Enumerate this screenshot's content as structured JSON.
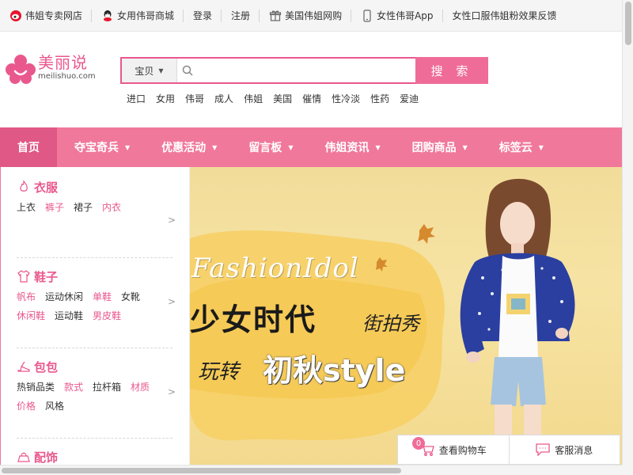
{
  "topbar": {
    "items": [
      {
        "label": "伟姐专卖网店",
        "icon": "weibo-icon"
      },
      {
        "label": "女用伟哥商城",
        "icon": "qq-icon"
      },
      {
        "label": "登录"
      },
      {
        "label": "注册"
      },
      {
        "label": "美国伟姐网购",
        "icon": "gift-icon"
      },
      {
        "label": "女性伟哥App",
        "icon": "phone-icon"
      },
      {
        "label": "女性口服伟姐粉效果反馈"
      }
    ]
  },
  "logo": {
    "name": "美丽说",
    "domain": "meilishuo.com"
  },
  "search": {
    "category": "宝贝",
    "placeholder": "",
    "button_label": "搜 索"
  },
  "hotwords": [
    "进口",
    "女用",
    "伟哥",
    "成人",
    "伟姐",
    "美国",
    "催情",
    "性冷淡",
    "性药",
    "爱迪"
  ],
  "nav": {
    "items": [
      {
        "label": "首页",
        "active": true
      },
      {
        "label": "夺宝奇兵"
      },
      {
        "label": "优惠活动"
      },
      {
        "label": "留言板"
      },
      {
        "label": "伟姐资讯"
      },
      {
        "label": "团购商品"
      },
      {
        "label": "标签云"
      }
    ]
  },
  "sidebar": {
    "categories": [
      {
        "name": "衣服",
        "icon": "flame-icon",
        "rows": [
          [
            {
              "t": "上衣"
            },
            {
              "t": "裤子",
              "hl": true
            },
            {
              "t": "裙子"
            },
            {
              "t": "内衣",
              "hl": true
            }
          ]
        ]
      },
      {
        "name": "鞋子",
        "icon": "tshirt-icon",
        "rows": [
          [
            {
              "t": "帆布",
              "hl": true
            },
            {
              "t": "运动休闲"
            },
            {
              "t": "单鞋",
              "hl": true
            },
            {
              "t": "女靴"
            }
          ],
          [
            {
              "t": "休闲鞋",
              "hl": true
            },
            {
              "t": "运动鞋"
            },
            {
              "t": "男皮鞋",
              "hl": true
            }
          ]
        ]
      },
      {
        "name": "包包",
        "icon": "heel-icon",
        "rows": [
          [
            {
              "t": "热销品类"
            },
            {
              "t": "款式",
              "hl": true
            },
            {
              "t": "拉杆箱"
            },
            {
              "t": "材质",
              "hl": true
            }
          ],
          [
            {
              "t": "价格",
              "hl": true
            },
            {
              "t": "风格"
            }
          ]
        ]
      },
      {
        "name": "配饰",
        "icon": "bag-icon",
        "rows": []
      }
    ],
    "arrow": ">"
  },
  "banner": {
    "line1": "FashionIdol",
    "line2": "少女时代",
    "line3": "街拍秀",
    "line4_prefix": "玩转",
    "line4": "初秋style"
  },
  "floatbar": {
    "cart_count": "0",
    "cart_label": "查看购物车",
    "service_label": "客服消息"
  },
  "colors": {
    "brand": "#e9588d",
    "nav": "#f0789b",
    "nav_active": "#e05885"
  }
}
